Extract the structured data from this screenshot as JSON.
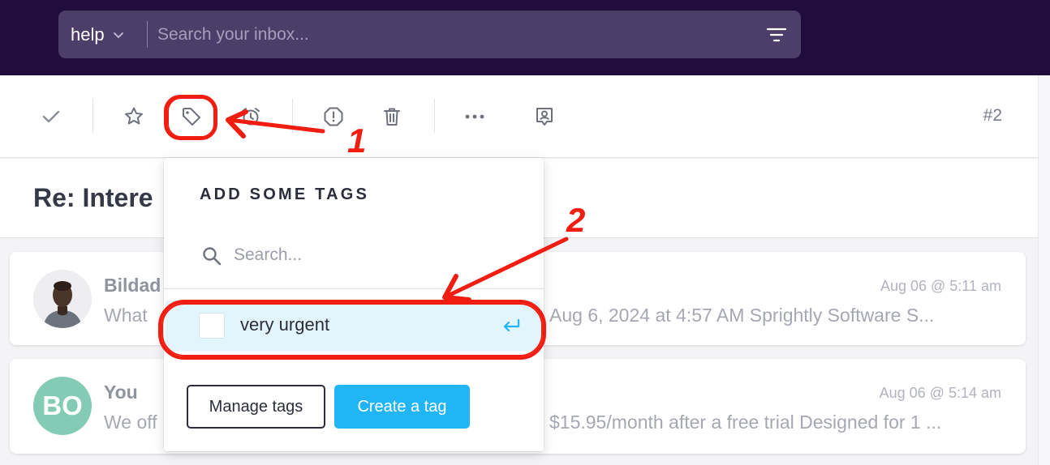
{
  "header": {
    "mailbox": "help",
    "search_placeholder": "Search your inbox..."
  },
  "toolbar": {
    "actions": [
      "close",
      "star",
      "tag",
      "snooze",
      "spam",
      "delete",
      "more",
      "assign"
    ],
    "ticket_number": "#2"
  },
  "thread": {
    "subject": "Re: Intere"
  },
  "messages": [
    {
      "sender": "Bildad",
      "snippet_start": "What",
      "snippet_end": "Aug 6, 2024 at 4:57 AM Sprightly Software S...",
      "time": "Aug 06 @ 5:11 am"
    },
    {
      "sender": "You",
      "initials": "BO",
      "snippet_start": "We off",
      "snippet_end": "$15.95/month after a free trial Designed for 1 ...",
      "time": "Aug 06 @ 5:14 am"
    }
  ],
  "tag_popover": {
    "title": "ADD SOME TAGS",
    "search_placeholder": "Search...",
    "tags": [
      {
        "label": "very urgent",
        "checked": false
      }
    ],
    "manage_label": "Manage tags",
    "create_label": "Create a tag"
  },
  "annotations": {
    "step1": "1",
    "step2": "2"
  },
  "colors": {
    "topbar": "#210d3d",
    "searchbar": "#4d3e69",
    "accent": "#22b5f5",
    "annotation": "#f11d10",
    "highlight_row": "#e2f4fc"
  }
}
